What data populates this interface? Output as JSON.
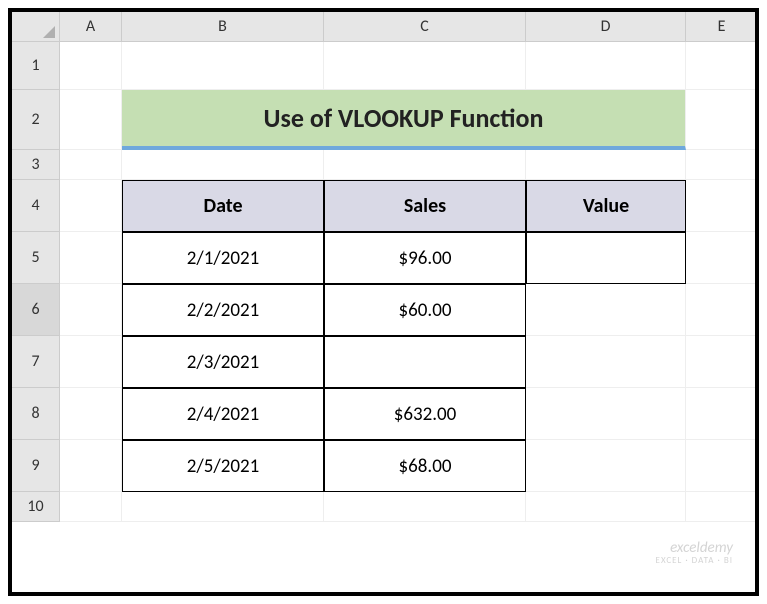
{
  "columns": [
    "A",
    "B",
    "C",
    "D",
    "E"
  ],
  "rows": [
    "1",
    "2",
    "3",
    "4",
    "5",
    "6",
    "7",
    "8",
    "9",
    "10"
  ],
  "title": "Use of VLOOKUP Function",
  "headers": {
    "date": "Date",
    "sales": "Sales",
    "value": "Value"
  },
  "data_rows": [
    {
      "date": "2/1/2021",
      "sales": "$96.00"
    },
    {
      "date": "2/2/2021",
      "sales": "$60.00"
    },
    {
      "date": "2/3/2021",
      "sales": ""
    },
    {
      "date": "2/4/2021",
      "sales": "$632.00"
    },
    {
      "date": "2/5/2021",
      "sales": "$68.00"
    }
  ],
  "watermark": {
    "main": "exceldemy",
    "sub": "EXCEL · DATA · BI"
  },
  "chart_data": {
    "type": "table",
    "title": "Use of VLOOKUP Function",
    "columns": [
      "Date",
      "Sales",
      "Value"
    ],
    "rows": [
      [
        "2/1/2021",
        96.0,
        null
      ],
      [
        "2/2/2021",
        60.0,
        null
      ],
      [
        "2/3/2021",
        null,
        null
      ],
      [
        "2/4/2021",
        632.0,
        null
      ],
      [
        "2/5/2021",
        68.0,
        null
      ]
    ]
  }
}
